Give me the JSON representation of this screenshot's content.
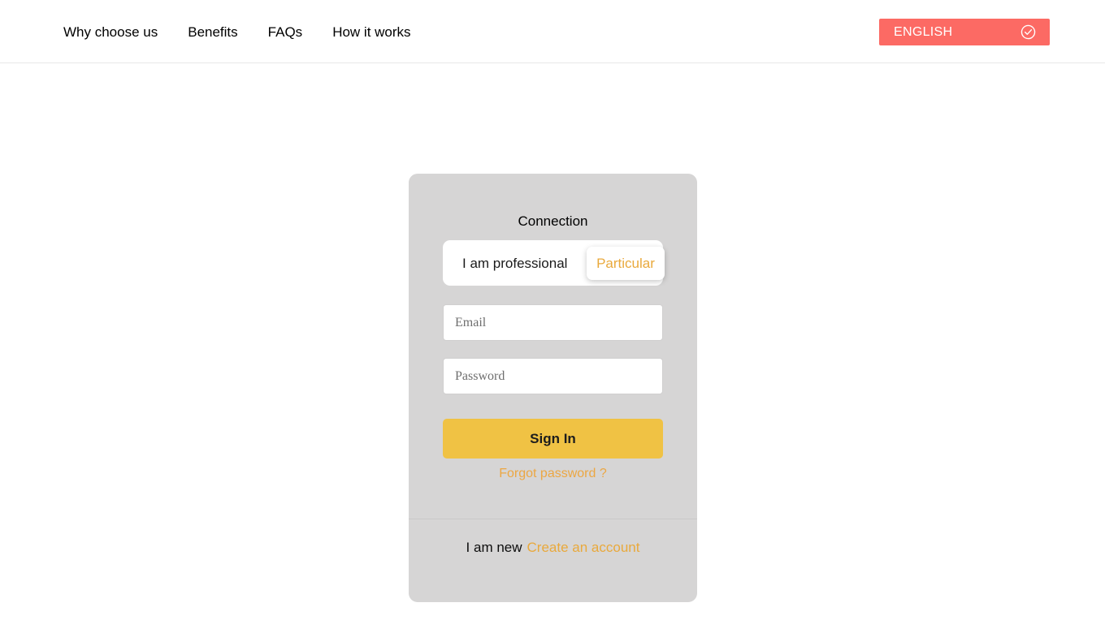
{
  "header": {
    "nav_items": [
      {
        "label": "Why choose us"
      },
      {
        "label": "Benefits"
      },
      {
        "label": "FAQs"
      },
      {
        "label": "How it works"
      }
    ],
    "language_button": {
      "label": "ENGLISH",
      "icon": "check-circle-icon",
      "background_color": "#fc6a64",
      "text_color": "#ffffff"
    }
  },
  "login_card": {
    "title": "Connection",
    "background_color": "#d6d5d5",
    "account_type_toggle": {
      "options": [
        {
          "label": "I am professional",
          "selected": false
        },
        {
          "label": "Particular",
          "selected": true
        }
      ],
      "selected_color": "#e9a93c"
    },
    "fields": {
      "email": {
        "placeholder": "Email",
        "value": ""
      },
      "password": {
        "placeholder": "Password",
        "value": ""
      }
    },
    "submit_button": {
      "label": "Sign In",
      "background_color": "#f0c244",
      "text_color": "#1d1d1d"
    },
    "forgot_password_link": {
      "label": "Forgot password ?",
      "color": "#eca743"
    },
    "footer": {
      "text": "I am new",
      "link_label": "Create an account",
      "link_color": "#e9a93c"
    }
  }
}
